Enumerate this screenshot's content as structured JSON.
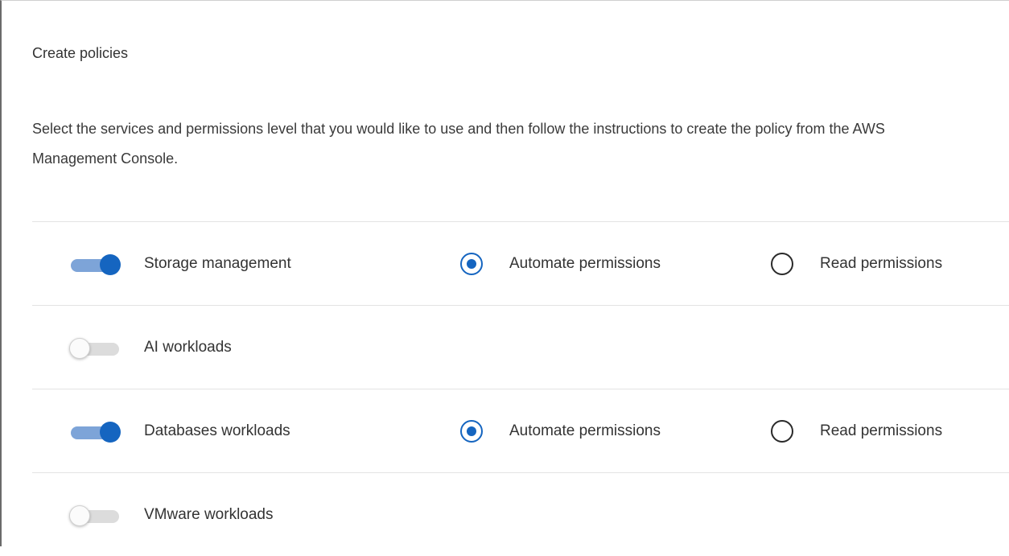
{
  "panel": {
    "title": "Create policies",
    "description": "Select the services and permissions level that you would like to use and then follow the instructions to create the policy from the AWS Management Console."
  },
  "colors": {
    "accent": "#1565c0",
    "toggle_track_on": "#7da4d8",
    "toggle_track_off": "#dcdcdc",
    "divider": "#e3e3e3"
  },
  "services": [
    {
      "label": "Storage management",
      "enabled": true,
      "permission_options": [
        "Automate permissions",
        "Read permissions"
      ],
      "selected_permission": "Automate permissions"
    },
    {
      "label": "AI workloads",
      "enabled": false
    },
    {
      "label": "Databases workloads",
      "enabled": true,
      "permission_options": [
        "Automate permissions",
        "Read permissions"
      ],
      "selected_permission": "Automate permissions"
    },
    {
      "label": "VMware workloads",
      "enabled": false
    }
  ]
}
